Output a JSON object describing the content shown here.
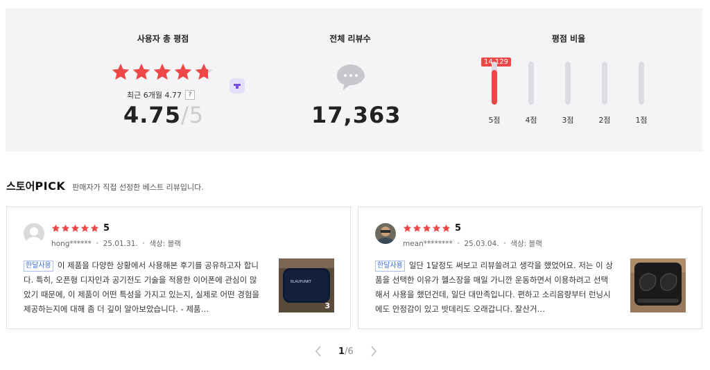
{
  "summary": {
    "rating_title": "사용자 총 평점",
    "recent_label": "최근 6개월 4.77",
    "help_label": "?",
    "score": "4.75",
    "score_slash": "/",
    "score_max": "5",
    "star_rating": 4.75,
    "reviews_title": "전체 리뷰수",
    "total_reviews": "17,363",
    "ratio_title": "평점 비율",
    "ratio_bars": [
      {
        "label": "5점",
        "fill_fraction": 0.81
      },
      {
        "label": "4점",
        "fill_fraction": 0
      },
      {
        "label": "3점",
        "fill_fraction": 0
      },
      {
        "label": "2점",
        "fill_fraction": 0
      },
      {
        "label": "1점",
        "fill_fraction": 0
      }
    ],
    "top_count": "14,129",
    "accent_color": "#ee4747"
  },
  "pick": {
    "title_prefix": "스토어",
    "title_bold": "PICK",
    "subtitle": "판매자가 직접 선정한 베스트 리뷰입니다."
  },
  "reviews": [
    {
      "stars": 5,
      "score": "5",
      "user": "hong******",
      "date": "25.01.31.",
      "option": "색상: 블랙",
      "tag": "한달사용",
      "text": "이 제품을 다양한 상황에서 사용해본 후기를 공유하고자 합니다. 특히, 오픈형 디자인과 공기전도 기술을 적용한 이어폰에 관심이 많았기 때문에, 이 제품이 어떤 특성을 가지고 있는지, 실제로 어떤 경험을 제공하는지에 대해 좀 더 깊이 알아보았습니다. - 제품…",
      "photo_count": "3",
      "brand_on_photo": "BLAUPUNKT"
    },
    {
      "stars": 5,
      "score": "5",
      "user": "mean********",
      "date": "25.03.04.",
      "option": "색상: 블랙",
      "tag": "한달사용",
      "text": "일단 1달정도 써보고 리뷰쓸려고 생각을 했었어요. 저는 이 상품을 선택한 이유가 헬스장을 매일 가니깐 운동하면서 이용하려고 선택해서 사용을 했던건데, 일단 대만족입니다. 편하고 소리음량부터 런닝시에도 안정감이 있고 밧데리도 오래갑니다. 잘산거…"
    }
  ],
  "pager": {
    "current": "1",
    "separator": "/",
    "total": "6"
  },
  "icons": [
    "star-icon",
    "badge-icon",
    "speech-bubble-icon",
    "chevron-left-icon",
    "chevron-right-icon"
  ]
}
